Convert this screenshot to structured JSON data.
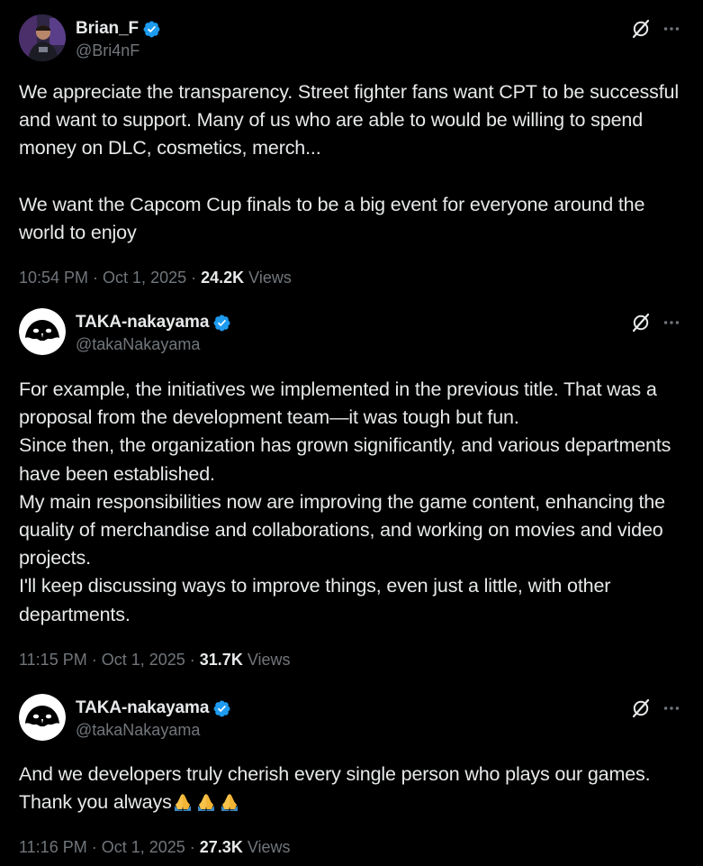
{
  "colors": {
    "background": "#000000",
    "text_primary": "#e7e9ea",
    "text_secondary": "#71767b",
    "verified_blue": "#1d9bf0"
  },
  "tweets": [
    {
      "display_name": "Brian_F",
      "handle": "@Bri4nF",
      "verified": true,
      "avatar": "photo-avatar",
      "text": "We appreciate the transparency. Street fighter fans want CPT to be successful and want to support. Many of us who are able to would be willing to spend money on DLC, cosmetics, merch...\n\nWe want the Capcom Cup finals to be a big event for everyone around the world to enjoy",
      "time": "10:54 PM",
      "date": "Oct 1, 2025",
      "views_count": "24.2K",
      "views_label": "Views"
    },
    {
      "display_name": "TAKA-nakayama",
      "handle": "@takaNakayama",
      "verified": true,
      "avatar": "ghost-face-avatar",
      "text": "For example, the initiatives we implemented in the previous title. That was a proposal from the development team—it was tough but fun.\nSince then, the organization has grown significantly, and various departments have been established.\nMy main responsibilities now are improving the game content, enhancing the quality of merchandise and collaborations, and working on movies and video projects.\nI'll keep discussing ways to improve things, even just a little, with other departments.",
      "time": "11:15 PM",
      "date": "Oct 1, 2025",
      "views_count": "31.7K",
      "views_label": "Views"
    },
    {
      "display_name": "TAKA-nakayama",
      "handle": "@takaNakayama",
      "verified": true,
      "avatar": "ghost-face-avatar",
      "text": "And we developers truly cherish every single person who plays our games. Thank you always",
      "emoji": "folded-hands-emoji",
      "emoji_count": 3,
      "time": "11:16 PM",
      "date": "Oct 1, 2025",
      "views_count": "27.3K",
      "views_label": "Views"
    }
  ]
}
